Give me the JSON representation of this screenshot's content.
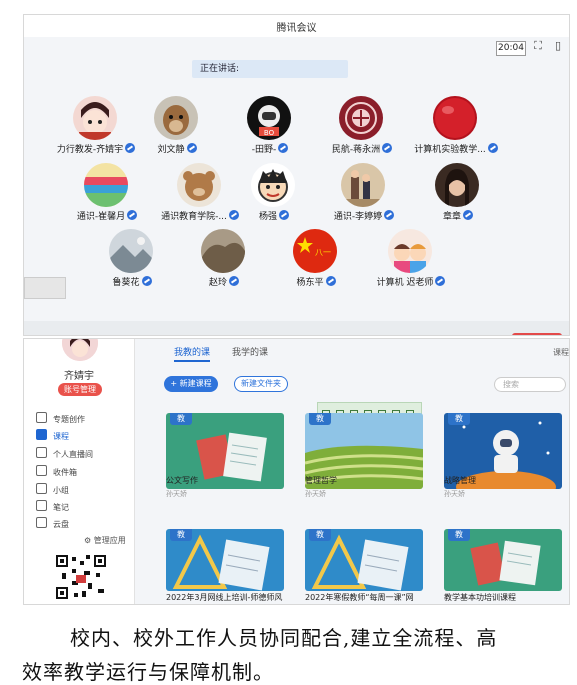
{
  "meeting": {
    "title": "腾讯会议",
    "time": "20:04",
    "speaking_label": "正在讲话:",
    "participants": [
      {
        "name": "力行教发-齐婧宇",
        "avatar": "cartoon-girl-avatar"
      },
      {
        "name": "刘文静",
        "avatar": "dog-avatar"
      },
      {
        "name": "-田野-",
        "avatar": "astronaut-avatar"
      },
      {
        "name": "民航-蒋永洲",
        "avatar": "emblem-avatar"
      },
      {
        "name": "计算机实验教学...",
        "avatar": "red-ball-avatar"
      },
      {
        "name": "通识-崔馨月",
        "avatar": "colorful-drawing-avatar"
      },
      {
        "name": "通识教育学院-...",
        "avatar": "teddy-bear-avatar"
      },
      {
        "name": "杨强",
        "avatar": "cartoon-boy-avatar"
      },
      {
        "name": "通识-李婷婷",
        "avatar": "family-photo-avatar"
      },
      {
        "name": "章章",
        "avatar": "woman-photo-avatar"
      },
      {
        "name": "鲁葵花",
        "avatar": "landscape-avatar"
      },
      {
        "name": "赵玲",
        "avatar": "rock-avatar"
      },
      {
        "name": "杨东平",
        "avatar": "china-flag-avatar"
      },
      {
        "name": "计算机 迟老师",
        "avatar": "kids-cartoon-avatar"
      }
    ]
  },
  "platform": {
    "user_name": "齐婧宇",
    "manage_badge": "账号管理",
    "tabs": [
      "我教的课",
      "我学的课"
    ],
    "right_tag": "课程",
    "new_course": "+ 新建课程",
    "new_folder": "新建文件夹",
    "search_placeholder": "搜索",
    "sidebar": [
      {
        "label": "专题创作",
        "icon": "book-icon"
      },
      {
        "label": "课程",
        "icon": "course-icon",
        "active": true
      },
      {
        "label": "个人直播间",
        "icon": "live-icon"
      },
      {
        "label": "收件箱",
        "icon": "inbox-icon"
      },
      {
        "label": "小组",
        "icon": "group-icon"
      },
      {
        "label": "笔记",
        "icon": "note-icon"
      },
      {
        "label": "云盘",
        "icon": "cloud-icon"
      }
    ],
    "manage_apps": "管理应用",
    "card_badge": "教",
    "courses": [
      {
        "title": "公文写作",
        "teacher": "孙天娇",
        "cover": "books-cover"
      },
      {
        "title": "管理哲学",
        "teacher": "孙天娇",
        "cover": "terraces-cover"
      },
      {
        "title": "战略管理",
        "teacher": "孙天娇",
        "cover": "astronaut-cover"
      },
      {
        "title": "2022年3月网线上培训-师德师风",
        "teacher": "",
        "cover": "notebook-cover"
      },
      {
        "title": "2022年寒假教师“每周一课”网",
        "teacher": "",
        "cover": "notebook-cover"
      },
      {
        "title": "教学基本功培训课程",
        "teacher": "",
        "cover": "books-cover"
      }
    ]
  },
  "caption": {
    "line1": "校内、校外工作人员协同配合,建立全流程、高",
    "line2": "效率教学运行与保障机制。"
  }
}
